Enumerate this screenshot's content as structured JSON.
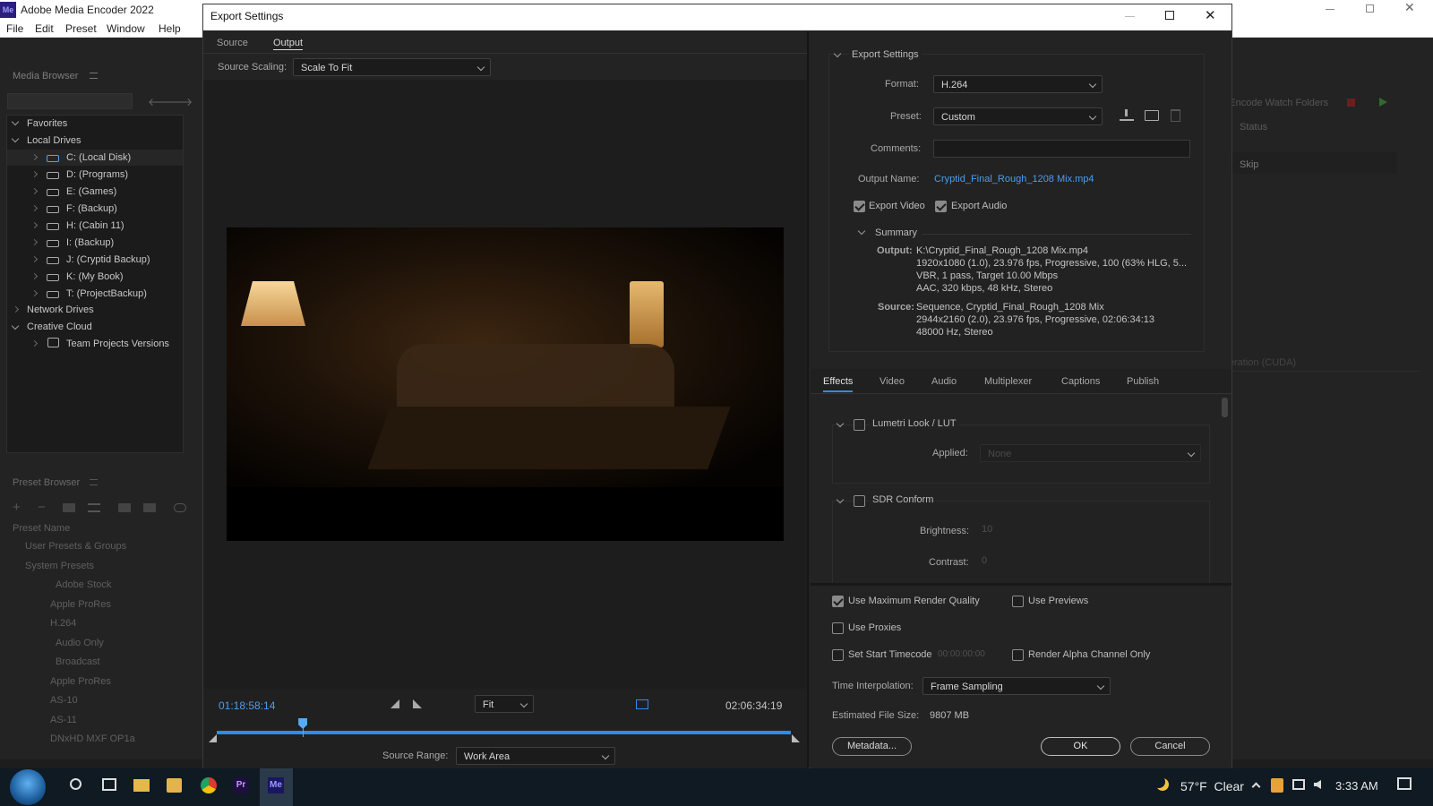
{
  "app": {
    "title": "Adobe Media Encoder 2022",
    "menu": [
      "File",
      "Edit",
      "Preset",
      "Window",
      "Help"
    ]
  },
  "media_browser": {
    "title": "Media Browser",
    "tree": [
      {
        "label": "Favorites"
      },
      {
        "label": "Local Drives"
      },
      {
        "label": "C: (Local Disk)"
      },
      {
        "label": "D: (Programs)"
      },
      {
        "label": "E: (Games)"
      },
      {
        "label": "F: (Backup)"
      },
      {
        "label": "H: (Cabin 11)"
      },
      {
        "label": "I: (Backup)"
      },
      {
        "label": "J: (Cryptid Backup)"
      },
      {
        "label": "K: (My Book)"
      },
      {
        "label": "T: (ProjectBackup)"
      },
      {
        "label": "Network Drives"
      },
      {
        "label": "Creative Cloud"
      },
      {
        "label": "Team Projects Versions"
      }
    ]
  },
  "preset_browser": {
    "title": "Preset Browser",
    "column": "Preset Name",
    "items": [
      "User Presets & Groups",
      "System Presets",
      "Adobe Stock",
      "Apple ProRes",
      "H.264",
      "Audio Only",
      "Broadcast",
      "Apple ProRes",
      "AS-10",
      "AS-11",
      "DNxHD MXF OP1a"
    ]
  },
  "queue": {
    "watch_folders": "Auto-Encode Watch Folders",
    "status_col": "Status",
    "row_status": "Skip",
    "renderer": "Acceleration (CUDA)"
  },
  "dialog": {
    "title": "Export Settings",
    "tabs": [
      "Source",
      "Output"
    ],
    "source_scaling_label": "Source Scaling:",
    "source_scaling_value": "Scale To Fit",
    "timecode_current": "01:18:58:14",
    "timecode_end": "02:06:34:19",
    "zoom": "Fit",
    "playhead_fraction": 0.15,
    "source_range_label": "Source Range:",
    "source_range_value": "Work Area",
    "export_settings": {
      "heading": "Export Settings",
      "format_label": "Format:",
      "format_value": "H.264",
      "preset_label": "Preset:",
      "preset_value": "Custom",
      "comments_label": "Comments:",
      "output_name_label": "Output Name:",
      "output_name_value": "Cryptid_Final_Rough_1208 Mix.mp4",
      "export_video": "Export Video",
      "export_audio": "Export Audio",
      "summary": "Summary",
      "output_label": "Output:",
      "output_lines": [
        "K:\\Cryptid_Final_Rough_1208 Mix.mp4",
        "1920x1080 (1.0), 23.976 fps, Progressive, 100 (63% HLG, 5...",
        "VBR, 1 pass, Target 10.00 Mbps",
        "AAC, 320 kbps, 48 kHz, Stereo"
      ],
      "source_label": "Source:",
      "source_lines": [
        "Sequence, Cryptid_Final_Rough_1208 Mix",
        "2944x2160 (2.0), 23.976 fps, Progressive, 02:06:34:13",
        "48000 Hz, Stereo"
      ]
    },
    "settings_tabs": [
      "Effects",
      "Video",
      "Audio",
      "Multiplexer",
      "Captions",
      "Publish"
    ],
    "effects": {
      "lumetri": "Lumetri Look / LUT",
      "applied_label": "Applied:",
      "applied_value": "None",
      "sdr": "SDR Conform",
      "brightness_label": "Brightness:",
      "brightness_value": "10",
      "contrast_label": "Contrast:",
      "contrast_value": "0"
    },
    "options": {
      "max_quality": "Use Maximum Render Quality",
      "previews": "Use Previews",
      "proxies": "Use Proxies",
      "start_tc": "Set Start Timecode",
      "start_tc_value": "00:00:00:00",
      "alpha": "Render Alpha Channel Only",
      "interp_label": "Time Interpolation:",
      "interp_value": "Frame Sampling",
      "filesize_label": "Estimated File Size:",
      "filesize_value": "9807 MB"
    },
    "buttons": {
      "metadata": "Metadata...",
      "ok": "OK",
      "cancel": "Cancel"
    }
  },
  "taskbar": {
    "weather": "57°F  Clear",
    "time": "3:33 AM"
  },
  "colors": {
    "accent": "#2d8ceb",
    "link": "#4b9df0"
  }
}
